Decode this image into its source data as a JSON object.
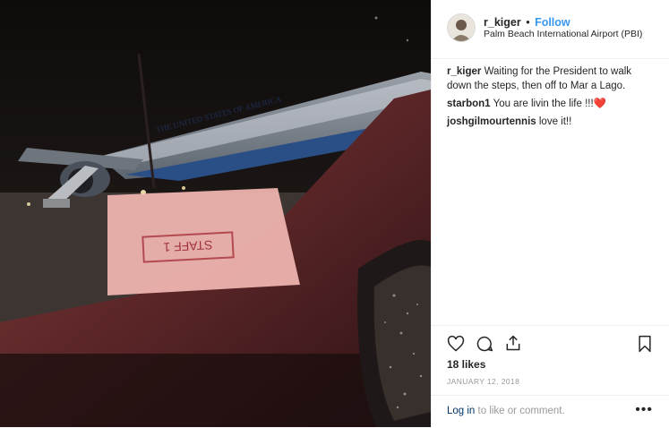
{
  "post": {
    "username": "r_kiger",
    "follow_label": "Follow",
    "separator": "•",
    "location": "Palm Beach International Airport (PBI)"
  },
  "comments": [
    {
      "author": "r_kiger",
      "text": "Waiting for the President to walk down the steps, then off to Mar a Lago."
    },
    {
      "author": "starbon1",
      "text": "You are livin the life !!!❤️"
    },
    {
      "author": "joshgilmourtennis",
      "text": "love it!!"
    }
  ],
  "photo": {
    "plane_lettering": "THE UNITED STATES OF AMERICA",
    "sign_text": "STAFF 1"
  },
  "actions": {
    "likes": "18 likes",
    "date": "JANUARY 12, 2018",
    "login_link": "Log in",
    "login_suffix": " to like or comment.",
    "more": "•••"
  },
  "icons": {
    "like": "heart-outline-icon",
    "comment": "speech-bubble-icon",
    "share": "share-upload-icon",
    "save": "bookmark-icon"
  },
  "colors": {
    "follow": "#3897f0",
    "link": "#003569",
    "muted": "#999999",
    "text": "#262626"
  }
}
